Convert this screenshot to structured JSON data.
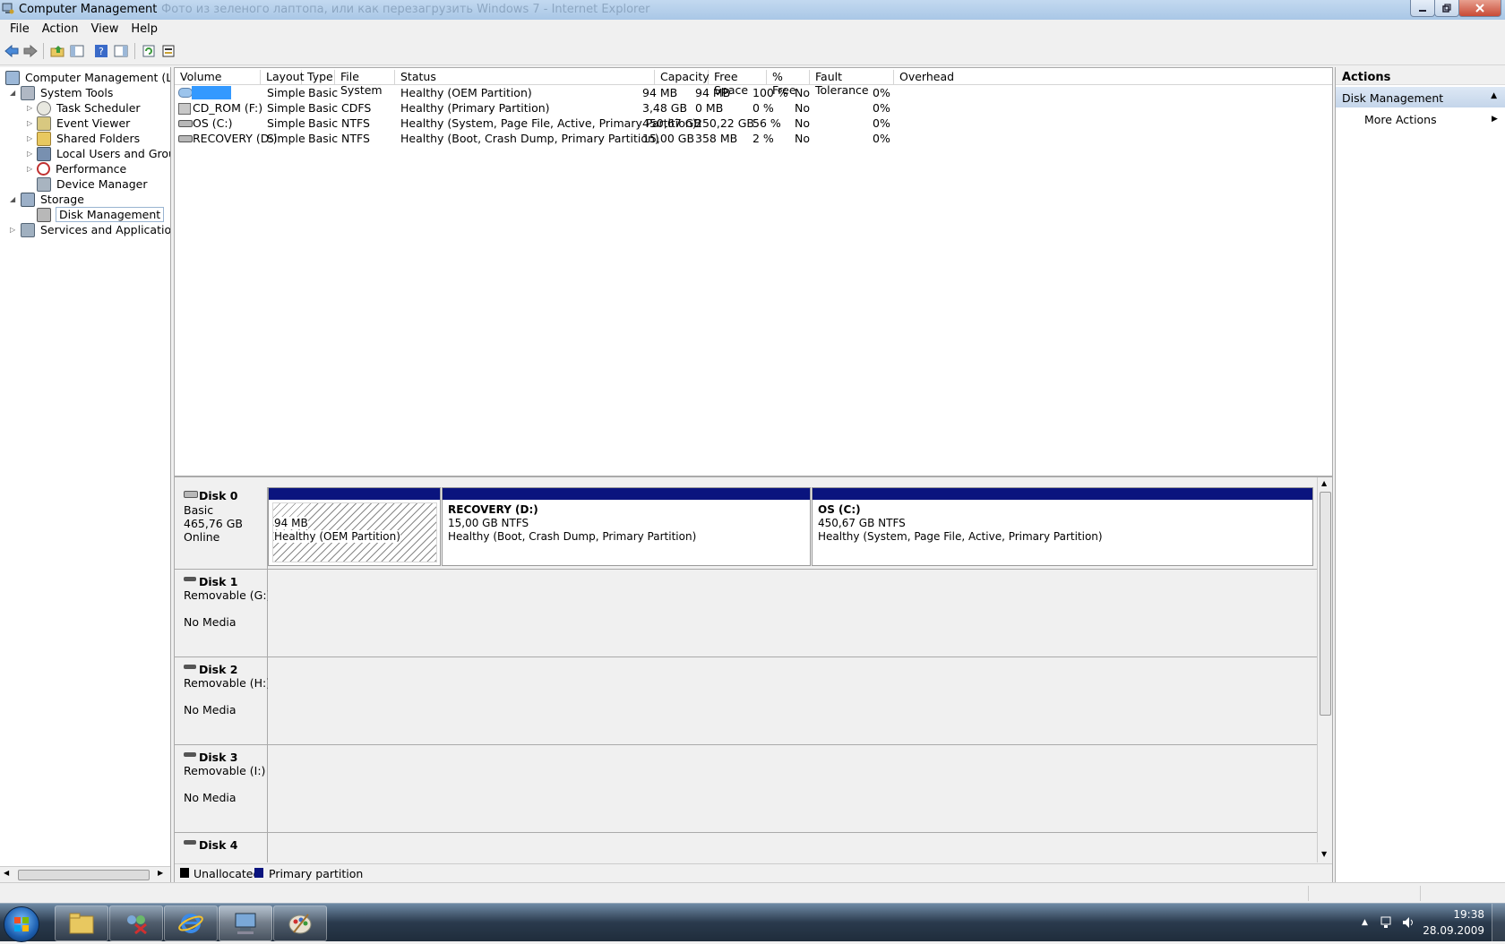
{
  "window": {
    "title": "Computer Management",
    "ghost_title": "Фото из зеленого лаптопа, или как перезагрузить Windows 7 - Internet Explorer"
  },
  "menu": [
    "File",
    "Action",
    "View",
    "Help"
  ],
  "tree": {
    "root": "Computer Management (Local",
    "system_tools": "System Tools",
    "task_scheduler": "Task Scheduler",
    "event_viewer": "Event Viewer",
    "shared_folders": "Shared Folders",
    "local_users": "Local Users and Groups",
    "performance": "Performance",
    "device_manager": "Device Manager",
    "storage": "Storage",
    "disk_management": "Disk Management",
    "services": "Services and Applications"
  },
  "volume_table": {
    "headers": [
      "Volume",
      "Layout",
      "Type",
      "File System",
      "Status",
      "Capacity",
      "Free Space",
      "% Free",
      "Fault Tolerance",
      "Overhead"
    ],
    "rows": [
      [
        "",
        "Simple",
        "Basic",
        "",
        "Healthy (OEM Partition)",
        "94 MB",
        "94 MB",
        "100 %",
        "No",
        "0%"
      ],
      [
        "CD_ROM (F:)",
        "Simple",
        "Basic",
        "CDFS",
        "Healthy (Primary Partition)",
        "3,48 GB",
        "0 MB",
        "0 %",
        "No",
        "0%"
      ],
      [
        "OS (C:)",
        "Simple",
        "Basic",
        "NTFS",
        "Healthy (System, Page File, Active, Primary Partition)",
        "450,67 GB",
        "250,22 GB",
        "56 %",
        "No",
        "0%"
      ],
      [
        "RECOVERY (D:)",
        "Simple",
        "Basic",
        "NTFS",
        "Healthy (Boot, Crash Dump, Primary Partition)",
        "15,00 GB",
        "358 MB",
        "2 %",
        "No",
        "0%"
      ]
    ]
  },
  "disks": {
    "disk0": {
      "name": "Disk 0",
      "type": "Basic",
      "size": "465,76 GB",
      "status": "Online",
      "partitions": [
        {
          "title": "",
          "size": "94 MB",
          "status": "Healthy (OEM Partition)"
        },
        {
          "title": "RECOVERY  (D:)",
          "size": "15,00 GB NTFS",
          "status": "Healthy (Boot, Crash Dump, Primary Partition)"
        },
        {
          "title": "OS  (C:)",
          "size": "450,67 GB NTFS",
          "status": "Healthy (System, Page File, Active, Primary Partition)"
        }
      ]
    },
    "disk1": {
      "name": "Disk 1",
      "type": "Removable (G:)",
      "status": "No Media"
    },
    "disk2": {
      "name": "Disk 2",
      "type": "Removable (H:)",
      "status": "No Media"
    },
    "disk3": {
      "name": "Disk 3",
      "type": "Removable (I:)",
      "status": "No Media"
    },
    "disk4": {
      "name": "Disk 4"
    }
  },
  "legend": {
    "unallocated": "Unallocated",
    "primary": "Primary partition",
    "unallocated_color": "#000000",
    "primary_color": "#0a147e"
  },
  "actions": {
    "header": "Actions",
    "section": "Disk Management",
    "more": "More Actions"
  },
  "taskbar": {
    "time": "19:38",
    "date": "28.09.2009",
    "buttons": [
      "explorer-icon",
      "remote-assistance-icon",
      "internet-explorer-icon",
      "computer-management-icon",
      "paint-icon"
    ]
  }
}
